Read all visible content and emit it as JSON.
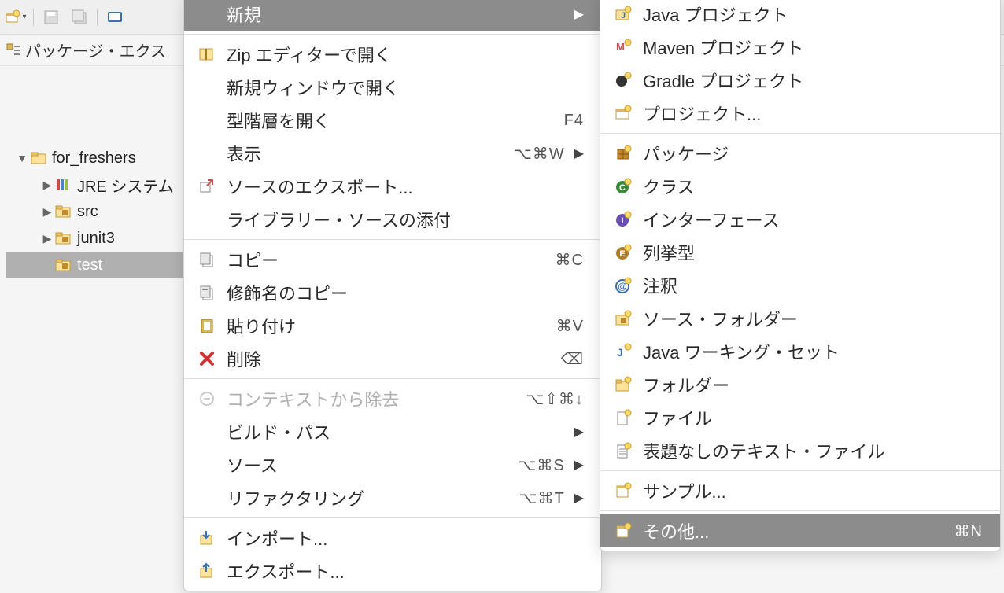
{
  "viewTab": {
    "label": "パッケージ・エクス"
  },
  "tree": {
    "root": {
      "label": "for_freshers",
      "caret": "▼"
    },
    "children": [
      {
        "label": "JRE システム",
        "caret": "▶",
        "icon": "library"
      },
      {
        "label": "src",
        "caret": "▶",
        "icon": "pkgfolder"
      },
      {
        "label": "junit3",
        "caret": "▶",
        "icon": "pkgfolder"
      },
      {
        "label": "test",
        "caret": "",
        "icon": "pkgfolder",
        "selected": true
      }
    ]
  },
  "contextMenu": {
    "groups": [
      [
        {
          "label": "新規",
          "hasSubmenu": true,
          "highlight": true,
          "icon": "none"
        }
      ],
      [
        {
          "label": "Zip エディターで開く",
          "icon": "zip"
        },
        {
          "label": "新規ウィンドウで開く",
          "icon": "none"
        },
        {
          "label": "型階層を開く",
          "shortcut": "F4",
          "icon": "none"
        },
        {
          "label": "表示",
          "shortcut": "⌥⌘W",
          "hasSubmenu": true,
          "icon": "none"
        },
        {
          "label": "ソースのエクスポート...",
          "icon": "export-src"
        },
        {
          "label": "ライブラリー・ソースの添付",
          "icon": "none"
        }
      ],
      [
        {
          "label": "コピー",
          "shortcut": "⌘C",
          "icon": "copy"
        },
        {
          "label": "修飾名のコピー",
          "icon": "copy-qual"
        },
        {
          "label": "貼り付け",
          "shortcut": "⌘V",
          "icon": "paste"
        },
        {
          "label": "削除",
          "shortcut": "⌫",
          "icon": "delete"
        }
      ],
      [
        {
          "label": "コンテキストから除去",
          "shortcut": "⌥⇧⌘↓",
          "icon": "remove-ctx",
          "disabled": true
        },
        {
          "label": "ビルド・パス",
          "hasSubmenu": true,
          "icon": "none"
        },
        {
          "label": "ソース",
          "shortcut": "⌥⌘S",
          "hasSubmenu": true,
          "icon": "none"
        },
        {
          "label": "リファクタリング",
          "shortcut": "⌥⌘T",
          "hasSubmenu": true,
          "icon": "none"
        }
      ],
      [
        {
          "label": "インポート...",
          "icon": "import"
        },
        {
          "label": "エクスポート...",
          "icon": "export"
        }
      ]
    ]
  },
  "submenu": {
    "groups": [
      [
        {
          "label": "Java プロジェクト",
          "icon": "java-project"
        },
        {
          "label": "Maven プロジェクト",
          "icon": "maven"
        },
        {
          "label": "Gradle プロジェクト",
          "icon": "gradle"
        },
        {
          "label": "プロジェクト...",
          "icon": "project"
        }
      ],
      [
        {
          "label": "パッケージ",
          "icon": "package"
        },
        {
          "label": "クラス",
          "icon": "class"
        },
        {
          "label": "インターフェース",
          "icon": "interface"
        },
        {
          "label": "列挙型",
          "icon": "enum"
        },
        {
          "label": "注釈",
          "icon": "annotation"
        },
        {
          "label": "ソース・フォルダー",
          "icon": "src-folder"
        },
        {
          "label": "Java ワーキング・セット",
          "icon": "workingset"
        },
        {
          "label": "フォルダー",
          "icon": "folder"
        },
        {
          "label": "ファイル",
          "icon": "file"
        },
        {
          "label": "表題なしのテキスト・ファイル",
          "icon": "textfile"
        }
      ],
      [
        {
          "label": "サンプル...",
          "icon": "sample"
        }
      ],
      [
        {
          "label": "その他...",
          "shortcut": "⌘N",
          "icon": "other",
          "highlight": true
        }
      ]
    ]
  }
}
